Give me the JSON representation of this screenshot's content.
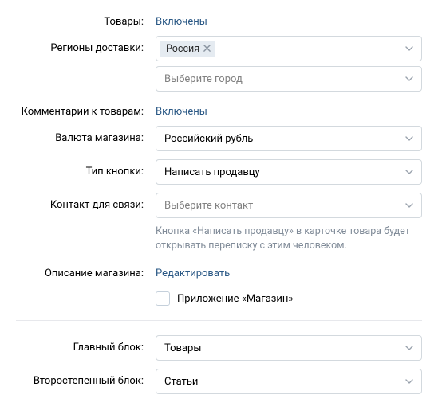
{
  "goods": {
    "label": "Товары:",
    "value_link": "Включены"
  },
  "delivery_regions": {
    "label": "Регионы доставки:",
    "tag": "Россия",
    "city_placeholder": "Выберите город"
  },
  "comments": {
    "label": "Комментарии к товарам:",
    "value_link": "Включены"
  },
  "currency": {
    "label": "Валюта магазина:",
    "value": "Российский рубль"
  },
  "button_type": {
    "label": "Тип кнопки:",
    "value": "Написать продавцу"
  },
  "contact": {
    "label": "Контакт для связи:",
    "placeholder": "Выберите контакт",
    "hint": "Кнопка «Написать продавцу» в карточке товара будет открывать переписку с этим человеком."
  },
  "description": {
    "label": "Описание магазина:",
    "value_link": "Редактировать"
  },
  "app_market": {
    "label": "Приложение «Магазин»"
  },
  "main_block": {
    "label": "Главный блок:",
    "value": "Товары"
  },
  "secondary_block": {
    "label": "Второстепенный блок:",
    "value": "Статьи"
  }
}
